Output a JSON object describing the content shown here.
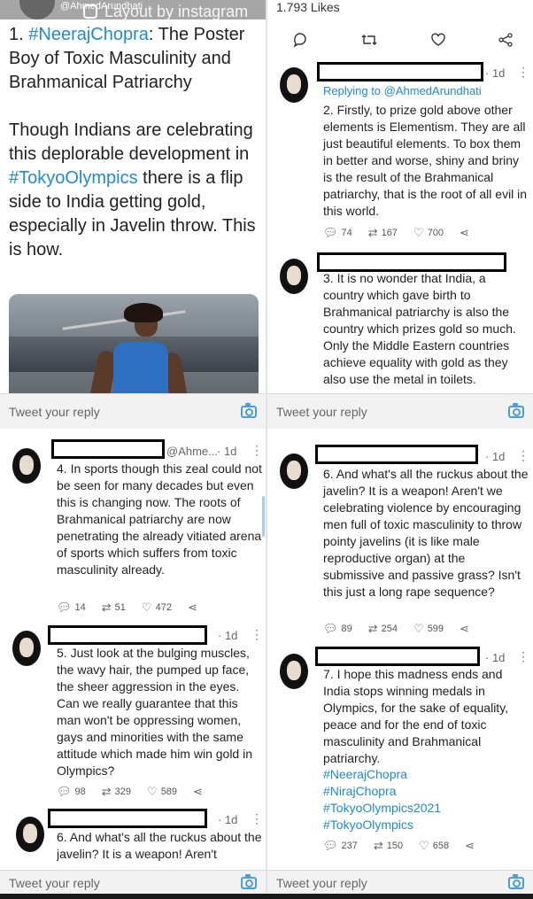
{
  "header": {
    "username": "@AhmedArundhati",
    "watermark": "Layout by instagram",
    "likes": "1.793 Likes"
  },
  "colors": {
    "accent": "#1d8bd6",
    "text": "#222222",
    "muted": "#666666"
  },
  "icons": {
    "reply": "comment-icon",
    "retweet": "retweet-icon",
    "like": "heart-icon",
    "share": "share-icon",
    "camera": "camera-icon"
  },
  "main_tweet": {
    "number": "1. ",
    "hashtag1": "#NeerajChopra",
    "title_rest": ": The Poster Boy of Toxic Masculinity and Brahmanical Patriarchy",
    "para_a": "Though Indians are celebrating this deplorable development in ",
    "hashtag2": "#TokyoOlympics",
    "para_b": " there is a flip side to India getting gold, especially in Javelin throw. This is how."
  },
  "reply_bar": {
    "placeholder": "Tweet your reply"
  },
  "panel2": {
    "tweet2": {
      "time": "· 1d",
      "replying": "Replying to @AhmedArundhati",
      "text": "2. Firstly, to prize gold above other elements is Elementism. They are all just beautiful elements. To box them in better and worse, shiny and briny is the result of the Brahmanical patriarchy, that is the root of all evil in this world.",
      "replies": "74",
      "retweets": "167",
      "likes": "700"
    },
    "tweet3": {
      "text": "3. It is no wonder that India, a country which gave birth to Brahmanical patriarchy is also the country which prizes gold so much. Only the Middle Eastern countries achieve equality with gold as they also use the metal in toilets."
    }
  },
  "panel3": {
    "tweet4": {
      "handle": "@Ahme...",
      "time": "· 1d",
      "text": "4. In sports though this zeal could not be seen for many decades but even this is changing now. The roots of Brahmanical patriarchy are now penetrating the already vitiated arena of sports which suffers from toxic masculinity already.",
      "replies": "14",
      "retweets": "51",
      "likes": "472"
    },
    "tweet5": {
      "time": "· 1d",
      "text": "5. Just look at the bulging muscles, the wavy hair, the pumped up face, the sheer aggression in the eyes. Can we really guarantee that this man won't be oppressing women, gays and minorities with the same attitude which made him win gold in Olympics?",
      "replies": "98",
      "retweets": "329",
      "likes": "589"
    },
    "tweet6_partial": {
      "time": "· 1d",
      "text": "6. And what's all the ruckus about the javelin? It is a weapon! Aren't"
    }
  },
  "panel4": {
    "tweet6": {
      "time": "· 1d",
      "text": "6. And what's all the ruckus about the javelin? It is a weapon! Aren't we celebrating violence by encouraging men full of toxic masculinity to throw pointy javelins (it is like male reproductive organ) at the submissive and passive grass? Isn't this just a long rape sequence?",
      "replies": "89",
      "retweets": "254",
      "likes": "599"
    },
    "tweet7": {
      "time": "· 1d",
      "text": "7. I hope this madness ends and India stops winning medals in Olympics, for the sake of equality, peace and for the end of toxic masculinity and Brahmanical patriarchy.",
      "hashtags": [
        "#NeerajChopra",
        "#NirajChopra",
        "#TokyoOlympics2021",
        "#TokyoOlympics"
      ],
      "replies": "237",
      "retweets": "150",
      "likes": "658"
    }
  }
}
